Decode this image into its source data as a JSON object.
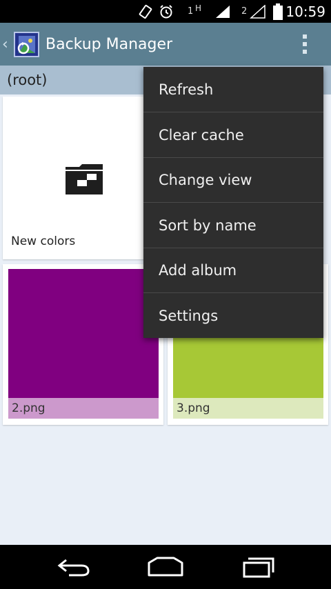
{
  "status_bar": {
    "time": "10:59",
    "sim1_label": "1",
    "sim1_net": "H",
    "sim2_label": "2",
    "icons": [
      "rotate-icon",
      "alarm-icon",
      "signal-icon",
      "signal-icon",
      "battery-icon"
    ]
  },
  "action_bar": {
    "title": "Backup Manager",
    "up_icon": "chevron-left-icon",
    "overflow_icon": "overflow-menu-icon"
  },
  "path": {
    "label": "(root)"
  },
  "grid": {
    "folder": {
      "label": "New colors",
      "icon": "folder-icon"
    },
    "images": [
      {
        "label": "2.png",
        "color": "#800080",
        "label_bg": "#cc99cc"
      },
      {
        "label": "3.png",
        "color": "#a7c836",
        "label_bg": "#dde9bd"
      }
    ]
  },
  "menu": {
    "items": [
      {
        "label": "Refresh"
      },
      {
        "label": "Clear cache"
      },
      {
        "label": "Change view"
      },
      {
        "label": "Sort by name"
      },
      {
        "label": "Add album"
      },
      {
        "label": "Settings"
      }
    ]
  },
  "nav_bar": {
    "icons": [
      "back-icon",
      "home-icon",
      "recent-apps-icon"
    ]
  },
  "colors": {
    "action_bar": "#5b7f91",
    "path_bar": "#a9bed0",
    "background": "#e9eff7",
    "menu_bg": "#2e2e2e"
  }
}
